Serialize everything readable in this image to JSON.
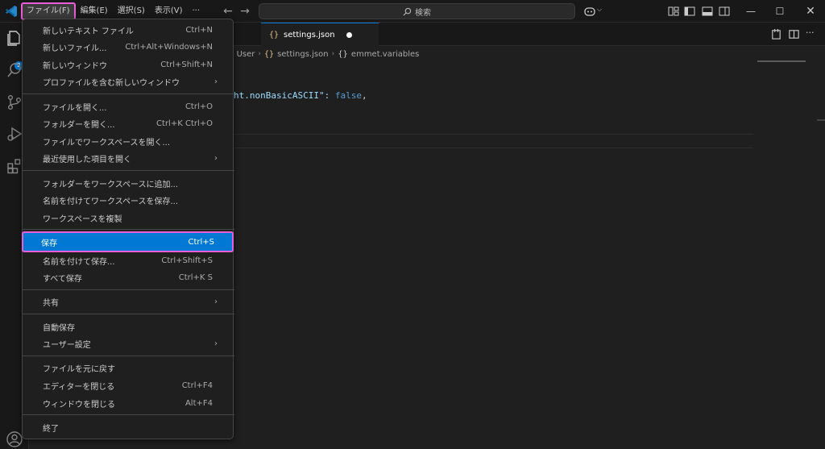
{
  "menubar": {
    "items": [
      "ファイル(F)",
      "編集(E)",
      "選択(S)",
      "表示(V)",
      "···"
    ]
  },
  "search": {
    "label": "検索"
  },
  "tab": {
    "label": "settings.json",
    "icon": "{}"
  },
  "breadcrumb": {
    "items": [
      "User",
      "settings.json",
      "emmet.variables"
    ],
    "icon": "{}"
  },
  "code": {
    "line1_text": "ht.nonBasicASCII\": ",
    "line1_value": "false",
    "line1_end": ","
  },
  "badge": {
    "count": "2"
  },
  "file_menu": {
    "items": [
      {
        "label": "新しいテキスト ファイル",
        "shortcut": "Ctrl+N"
      },
      {
        "label": "新しいファイル...",
        "shortcut": "Ctrl+Alt+Windows+N"
      },
      {
        "label": "新しいウィンドウ",
        "shortcut": "Ctrl+Shift+N"
      },
      {
        "label": "プロファイルを含む新しいウィンドウ",
        "shortcut": "›"
      },
      {
        "label": "ファイルを開く...",
        "shortcut": "Ctrl+O"
      },
      {
        "label": "フォルダーを開く...",
        "shortcut": "Ctrl+K Ctrl+O"
      },
      {
        "label": "ファイルでワークスペースを開く...",
        "shortcut": ""
      },
      {
        "label": "最近使用した項目を開く",
        "shortcut": "›"
      },
      {
        "label": "フォルダーをワークスペースに追加...",
        "shortcut": ""
      },
      {
        "label": "名前を付けてワークスペースを保存...",
        "shortcut": ""
      },
      {
        "label": "ワークスペースを複製",
        "shortcut": ""
      },
      {
        "label": "保存",
        "shortcut": "Ctrl+S"
      },
      {
        "label": "名前を付けて保存...",
        "shortcut": "Ctrl+Shift+S"
      },
      {
        "label": "すべて保存",
        "shortcut": "Ctrl+K S"
      },
      {
        "label": "共有",
        "shortcut": "›"
      },
      {
        "label": "自動保存",
        "shortcut": ""
      },
      {
        "label": "ユーザー設定",
        "shortcut": "›"
      },
      {
        "label": "ファイルを元に戻す",
        "shortcut": ""
      },
      {
        "label": "エディターを閉じる",
        "shortcut": "Ctrl+F4"
      },
      {
        "label": "ウィンドウを閉じる",
        "shortcut": "Alt+F4"
      },
      {
        "label": "終了",
        "shortcut": ""
      }
    ]
  },
  "colors": {
    "accent": "#0078d4",
    "highlight_border": "#e85dd8"
  }
}
